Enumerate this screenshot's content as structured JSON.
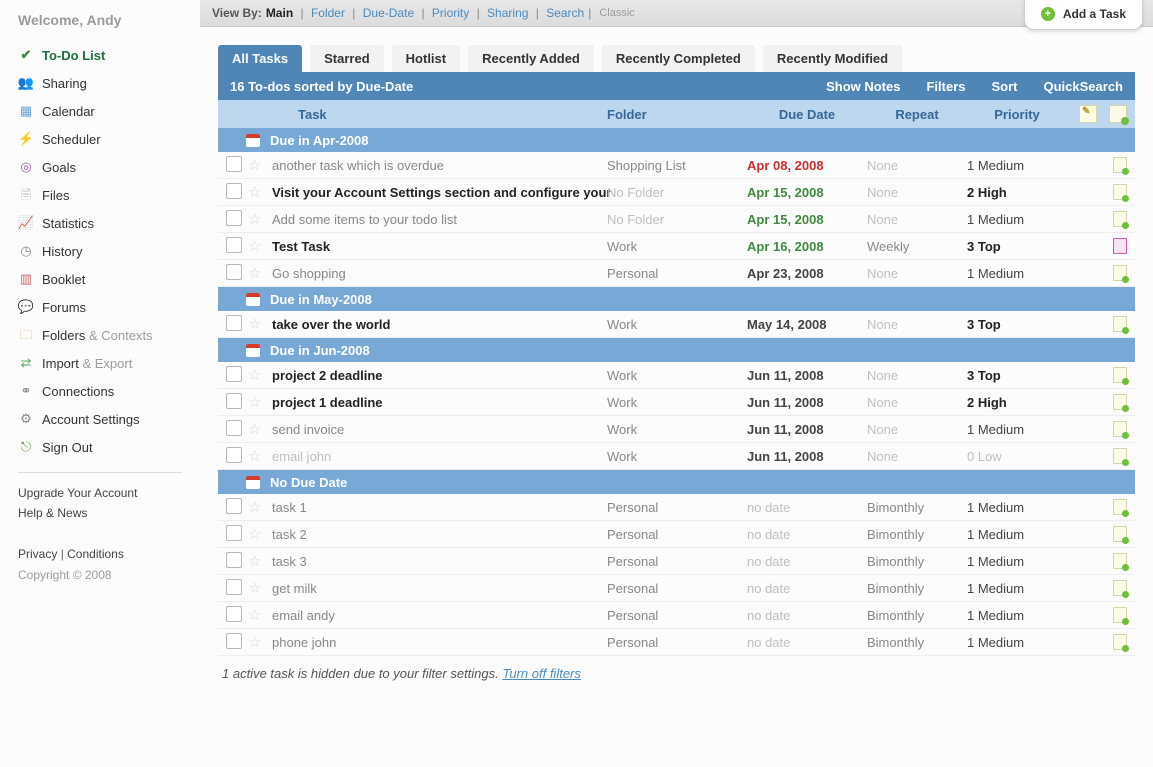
{
  "welcome": "Welcome, Andy",
  "sidebar": {
    "items": [
      {
        "label": "To-Do List",
        "icon": "✔",
        "color": "#3f8a3f",
        "selected": true
      },
      {
        "label": "Sharing",
        "icon": "👥",
        "color": "#d88a3a"
      },
      {
        "label": "Calendar",
        "icon": "▦",
        "color": "#6aa6d6"
      },
      {
        "label": "Scheduler",
        "icon": "⚡",
        "color": "#e5b83a"
      },
      {
        "label": "Goals",
        "icon": "◎",
        "color": "#9a5ea8"
      },
      {
        "label": "Files",
        "icon": "🗎",
        "color": "#b8b8b8"
      },
      {
        "label": "Statistics",
        "icon": "📈",
        "color": "#6a6a6a"
      },
      {
        "label": "History",
        "icon": "◷",
        "color": "#8a8a8a"
      },
      {
        "label": "Booklet",
        "icon": "▥",
        "color": "#c96a6a"
      },
      {
        "label": "Forums",
        "icon": "💬",
        "color": "#7aa0c8"
      },
      {
        "label": "Folders",
        "sublabel": " & Contexts",
        "icon": "🗀",
        "color": "#d8b84a"
      },
      {
        "label": "Import",
        "sublabel": " & Export",
        "icon": "⇄",
        "color": "#5aa85a"
      },
      {
        "label": "Connections",
        "icon": "⚭",
        "color": "#8a8a8a"
      },
      {
        "label": "Account Settings",
        "icon": "⚙",
        "color": "#8a8a8a"
      },
      {
        "label": "Sign Out",
        "icon": "⎋",
        "color": "#6a9a4a"
      }
    ],
    "footer": {
      "upgrade": "Upgrade Your Account",
      "help": "Help & News",
      "privacy": "Privacy",
      "conditions": "Conditions",
      "copyright": "Copyright © 2008"
    }
  },
  "viewbar": {
    "label": "View By:",
    "items": [
      "Main",
      "Folder",
      "Due-Date",
      "Priority",
      "Sharing",
      "Search"
    ],
    "current": "Main",
    "classic": "Classic"
  },
  "addtask": "Add a Task",
  "tabs": [
    "All Tasks",
    "Starred",
    "Hotlist",
    "Recently Added",
    "Recently Completed",
    "Recently Modified"
  ],
  "active_tab": "All Tasks",
  "summary": {
    "text": "16 To-dos sorted by Due-Date",
    "tools": [
      "Show Notes",
      "Filters",
      "Sort",
      "QuickSearch"
    ]
  },
  "columns": {
    "task": "Task",
    "folder": "Folder",
    "due": "Due Date",
    "repeat": "Repeat",
    "priority": "Priority"
  },
  "groups": [
    {
      "title": "Due in Apr-2008",
      "rows": [
        {
          "name": "another task which is overdue",
          "folder": "Shopping List",
          "due": "Apr 08, 2008",
          "due_cls": "overdue",
          "repeat": "None",
          "priority": "1 Medium",
          "bold": false
        },
        {
          "name": "Visit your Account Settings section and configure your",
          "folder": "No Folder",
          "folder_none": true,
          "due": "Apr 15, 2008",
          "due_cls": "soon",
          "repeat": "None",
          "priority": "2 High",
          "bold": true
        },
        {
          "name": "Add some items to your todo list",
          "folder": "No Folder",
          "folder_none": true,
          "due": "Apr 15, 2008",
          "due_cls": "soon",
          "repeat": "None",
          "priority": "1 Medium",
          "bold": false
        },
        {
          "name": "Test Task",
          "folder": "Work",
          "due": "Apr 16, 2008",
          "due_cls": "soon",
          "repeat": "Weekly",
          "priority": "3 Top",
          "bold": true,
          "has_note": true
        },
        {
          "name": "Go shopping",
          "folder": "Personal",
          "due": "Apr 23, 2008",
          "due_cls": "",
          "repeat": "None",
          "priority": "1 Medium",
          "bold": false
        }
      ]
    },
    {
      "title": "Due in May-2008",
      "rows": [
        {
          "name": "take over the world",
          "folder": "Work",
          "due": "May 14, 2008",
          "due_cls": "",
          "repeat": "None",
          "priority": "3 Top",
          "bold": true
        }
      ]
    },
    {
      "title": "Due in Jun-2008",
      "rows": [
        {
          "name": "project 2 deadline",
          "folder": "Work",
          "due": "Jun 11, 2008",
          "due_cls": "",
          "repeat": "None",
          "priority": "3 Top",
          "bold": true
        },
        {
          "name": "project 1 deadline",
          "folder": "Work",
          "due": "Jun 11, 2008",
          "due_cls": "",
          "repeat": "None",
          "priority": "2 High",
          "bold": true
        },
        {
          "name": "send invoice",
          "folder": "Work",
          "due": "Jun 11, 2008",
          "due_cls": "",
          "repeat": "None",
          "priority": "1 Medium",
          "bold": false
        },
        {
          "name": "email john",
          "folder": "Work",
          "due": "Jun 11, 2008",
          "due_cls": "",
          "repeat": "None",
          "priority": "0 Low",
          "bold": false,
          "low": true
        }
      ]
    },
    {
      "title": "No Due Date",
      "rows": [
        {
          "name": "task 1",
          "folder": "Personal",
          "due": "no date",
          "due_cls": "none",
          "repeat": "Bimonthly",
          "priority": "1 Medium",
          "bold": false
        },
        {
          "name": "task 2",
          "folder": "Personal",
          "due": "no date",
          "due_cls": "none",
          "repeat": "Bimonthly",
          "priority": "1 Medium",
          "bold": false
        },
        {
          "name": "task 3",
          "folder": "Personal",
          "due": "no date",
          "due_cls": "none",
          "repeat": "Bimonthly",
          "priority": "1 Medium",
          "bold": false
        },
        {
          "name": "get milk",
          "folder": "Personal",
          "due": "no date",
          "due_cls": "none",
          "repeat": "Bimonthly",
          "priority": "1 Medium",
          "bold": false
        },
        {
          "name": "email andy",
          "folder": "Personal",
          "due": "no date",
          "due_cls": "none",
          "repeat": "Bimonthly",
          "priority": "1 Medium",
          "bold": false
        },
        {
          "name": "phone john",
          "folder": "Personal",
          "due": "no date",
          "due_cls": "none",
          "repeat": "Bimonthly",
          "priority": "1 Medium",
          "bold": false
        }
      ]
    }
  ],
  "filter_msg": {
    "text": "1 active task is hidden due to your filter settings. ",
    "link": "Turn off filters"
  }
}
